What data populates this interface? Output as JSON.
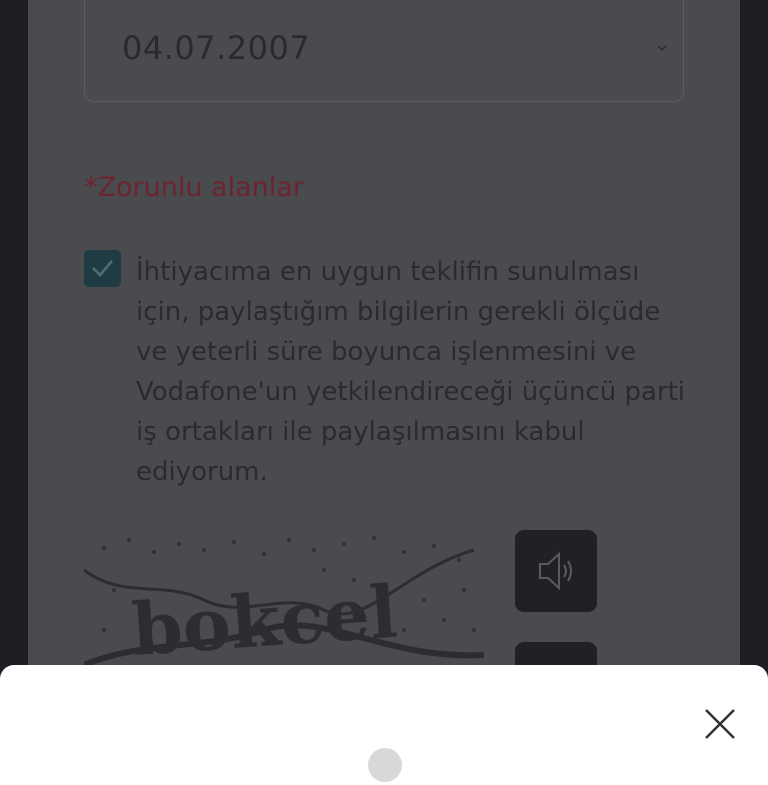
{
  "form": {
    "birth_date": {
      "value": "04.07.2007",
      "icon": "chevron-down-icon"
    },
    "required_note": "*Zorunlu alanlar",
    "consent": {
      "checked": true,
      "text": "İhtiyacıma en uygun teklifin sunulması için, paylaştığım bilgilerin gerekli ölçüde ve yeterli süre boyunca işlenmesini ve Vodafone'un yetkilendireceği üçüncü parti iş ortakları ile paylaşılmasını kabul ediyorum."
    },
    "captcha": {
      "audio_icon": "speaker-icon",
      "refresh_icon": "refresh-icon"
    }
  },
  "sheet": {
    "close_icon": "close-icon"
  },
  "colors": {
    "overlay_page": "#4a4b4e",
    "outer_background": "#1e1f24",
    "required_text": "#6b2430",
    "checkbox": "#1f3c44",
    "sheet_background": "#ffffff"
  }
}
